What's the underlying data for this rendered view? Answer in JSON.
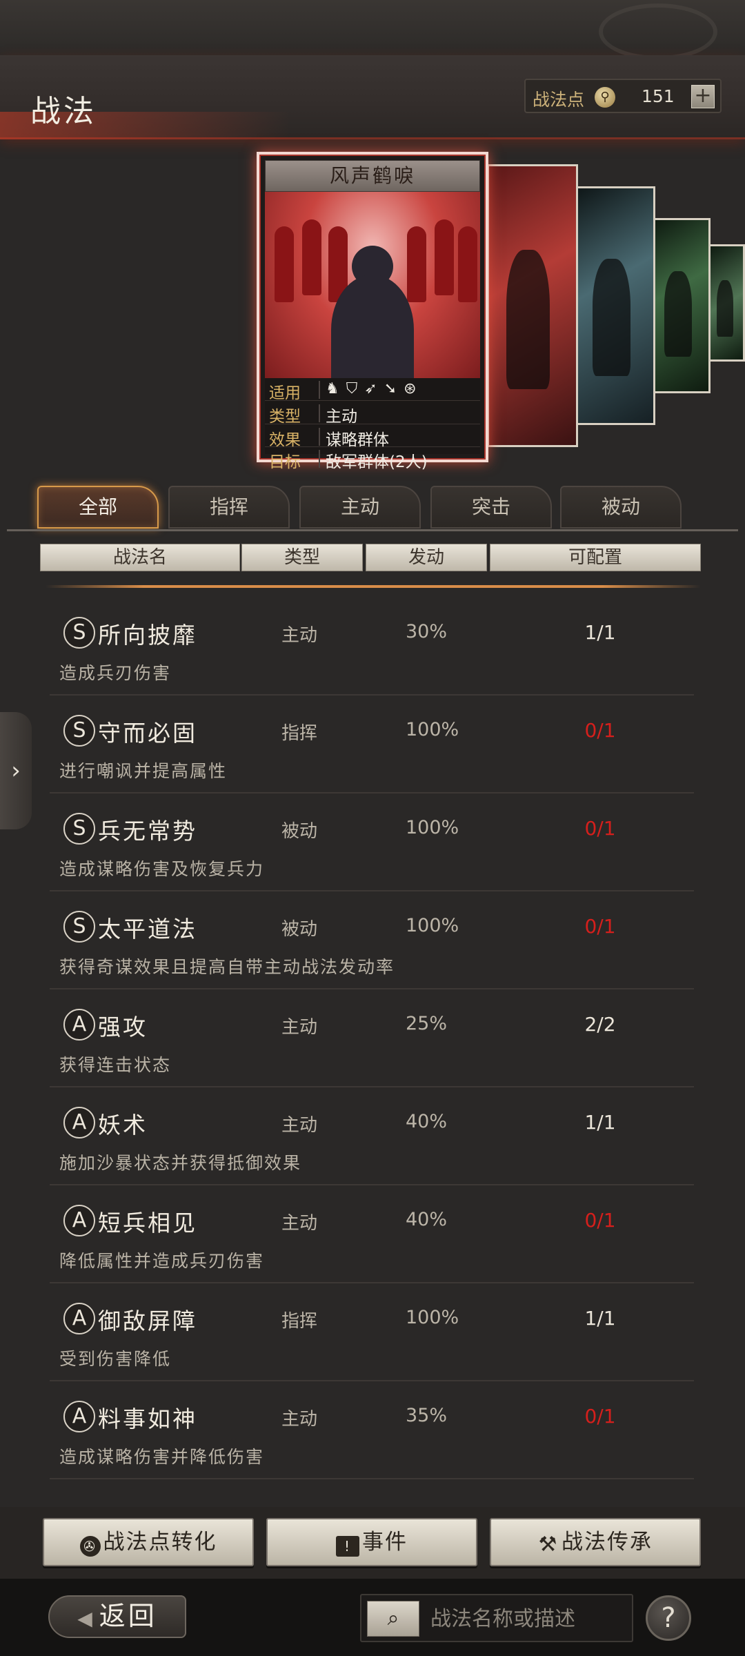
{
  "header": {
    "title": "战法",
    "points_label": "战法点",
    "points_value": "151",
    "add_label": "+"
  },
  "featured_card": {
    "name": "风声鹤唳",
    "stats": [
      {
        "key": "适用",
        "value": ""
      },
      {
        "key": "类型",
        "value": "主动"
      },
      {
        "key": "效果",
        "value": "谋略群体"
      },
      {
        "key": "目标",
        "value": "敌军群体(2人)"
      }
    ],
    "troop_icons": [
      "cavalry-icon",
      "shield-icon",
      "bow-icon",
      "spear-icon",
      "wheel-icon"
    ]
  },
  "tabs": [
    {
      "label": "全部",
      "active": true
    },
    {
      "label": "指挥",
      "active": false
    },
    {
      "label": "主动",
      "active": false
    },
    {
      "label": "突击",
      "active": false
    },
    {
      "label": "被动",
      "active": false
    }
  ],
  "columns": {
    "name": "战法名",
    "type": "类型",
    "rate": "发动",
    "config": "可配置"
  },
  "skills": [
    {
      "grade": "S",
      "name": "所向披靡",
      "type": "主动",
      "rate": "30%",
      "config": "1/1",
      "config_red": false,
      "desc": "造成兵刃伤害"
    },
    {
      "grade": "S",
      "name": "守而必固",
      "type": "指挥",
      "rate": "100%",
      "config": "0/1",
      "config_red": true,
      "desc": "进行嘲讽并提高属性"
    },
    {
      "grade": "S",
      "name": "兵无常势",
      "type": "被动",
      "rate": "100%",
      "config": "0/1",
      "config_red": true,
      "desc": "造成谋略伤害及恢复兵力"
    },
    {
      "grade": "S",
      "name": "太平道法",
      "type": "被动",
      "rate": "100%",
      "config": "0/1",
      "config_red": true,
      "desc": "获得奇谋效果且提高自带主动战法发动率"
    },
    {
      "grade": "A",
      "name": "强攻",
      "type": "主动",
      "rate": "25%",
      "config": "2/2",
      "config_red": false,
      "desc": "获得连击状态"
    },
    {
      "grade": "A",
      "name": "妖术",
      "type": "主动",
      "rate": "40%",
      "config": "1/1",
      "config_red": false,
      "desc": "施加沙暴状态并获得抵御效果"
    },
    {
      "grade": "A",
      "name": "短兵相见",
      "type": "主动",
      "rate": "40%",
      "config": "0/1",
      "config_red": true,
      "desc": "降低属性并造成兵刃伤害"
    },
    {
      "grade": "A",
      "name": "御敌屏障",
      "type": "指挥",
      "rate": "100%",
      "config": "1/1",
      "config_red": false,
      "desc": "受到伤害降低"
    },
    {
      "grade": "A",
      "name": "料事如神",
      "type": "主动",
      "rate": "35%",
      "config": "0/1",
      "config_red": true,
      "desc": "造成谋略伤害并降低伤害"
    }
  ],
  "actions": [
    {
      "icon": "swirl-icon",
      "label": "战法点转化"
    },
    {
      "icon": "alert-icon",
      "label": "事件"
    },
    {
      "icon": "hammer-icon",
      "label": "战法传承"
    }
  ],
  "footer": {
    "back_label": "返回",
    "search_placeholder": "战法名称或描述",
    "help_label": "?"
  },
  "colors": {
    "accent_red": "#d51f1c",
    "tab_glow": "#d79a4a",
    "gold_label": "#d8b266"
  }
}
